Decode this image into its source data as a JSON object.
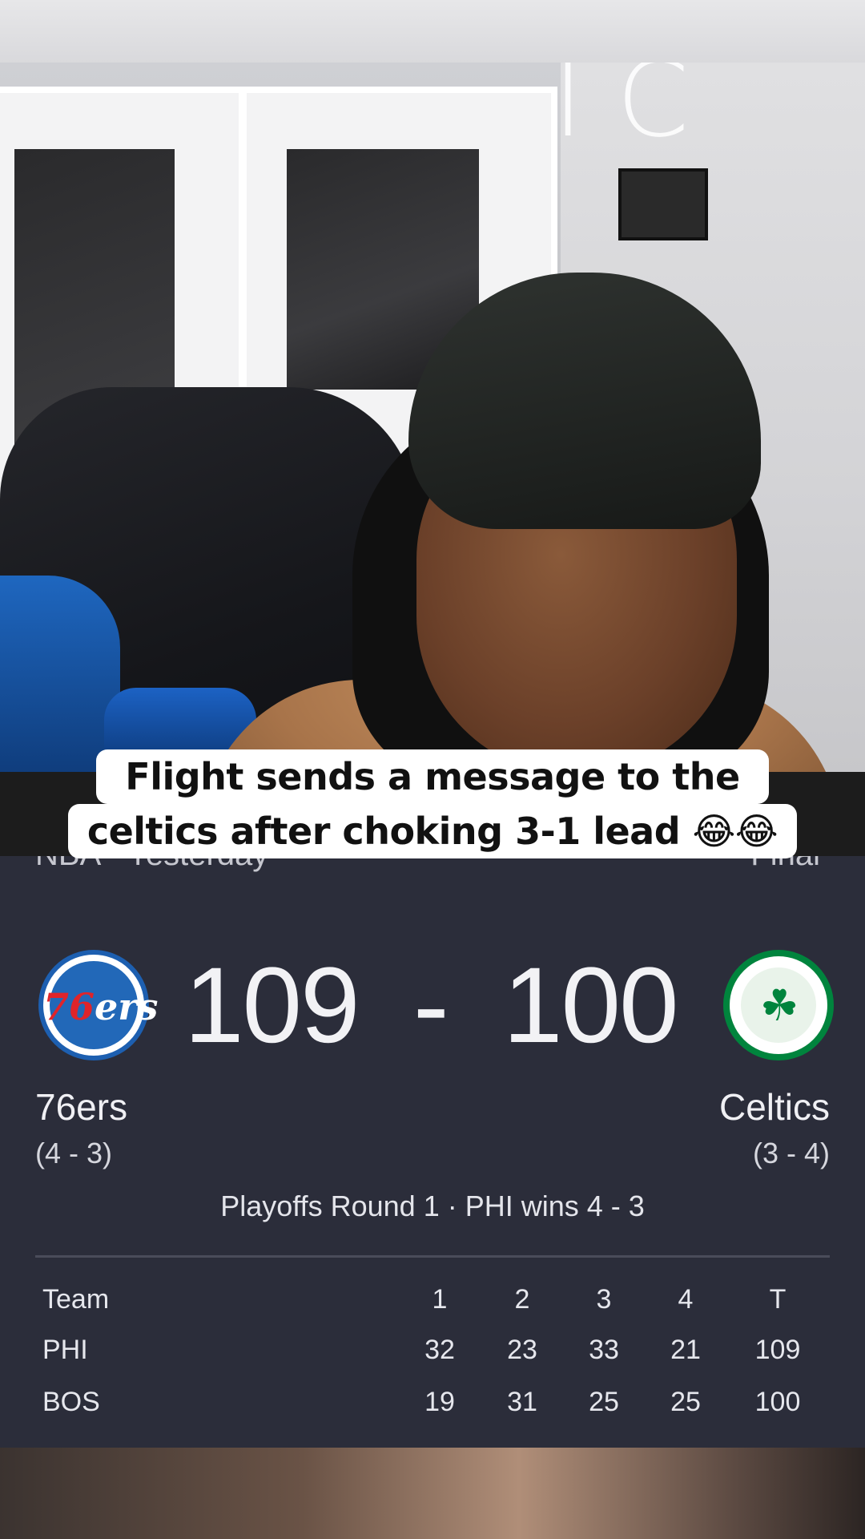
{
  "caption": {
    "line1": "Flight sends a message to the",
    "line2": "celtics after choking 3-1 lead 😂😂"
  },
  "scorecard": {
    "league_date": "NBA · Yesterday",
    "status": "Final",
    "home": {
      "name": "76ers",
      "record": "(4 - 3)",
      "score": "109",
      "abbr": "PHI"
    },
    "away": {
      "name": "Celtics",
      "record": "(3 - 4)",
      "score": "100",
      "abbr": "BOS"
    },
    "separator": "-",
    "series_info": "Playoffs Round 1 · PHI wins 4 - 3",
    "box_score": {
      "headers": [
        "Team",
        "1",
        "2",
        "3",
        "4",
        "T"
      ],
      "rows": [
        [
          "PHI",
          "32",
          "23",
          "33",
          "21",
          "109"
        ],
        [
          "BOS",
          "19",
          "31",
          "25",
          "25",
          "100"
        ]
      ]
    }
  },
  "logos": {
    "home_logo_text": "76ers",
    "away_logo_icon": "celtics-leprechaun-icon"
  },
  "colors": {
    "card_bg": "#2b2d3a",
    "caption_bg": "#ffffff",
    "sixers_blue": "#1d5fb0",
    "celtics_green": "#00843d"
  }
}
